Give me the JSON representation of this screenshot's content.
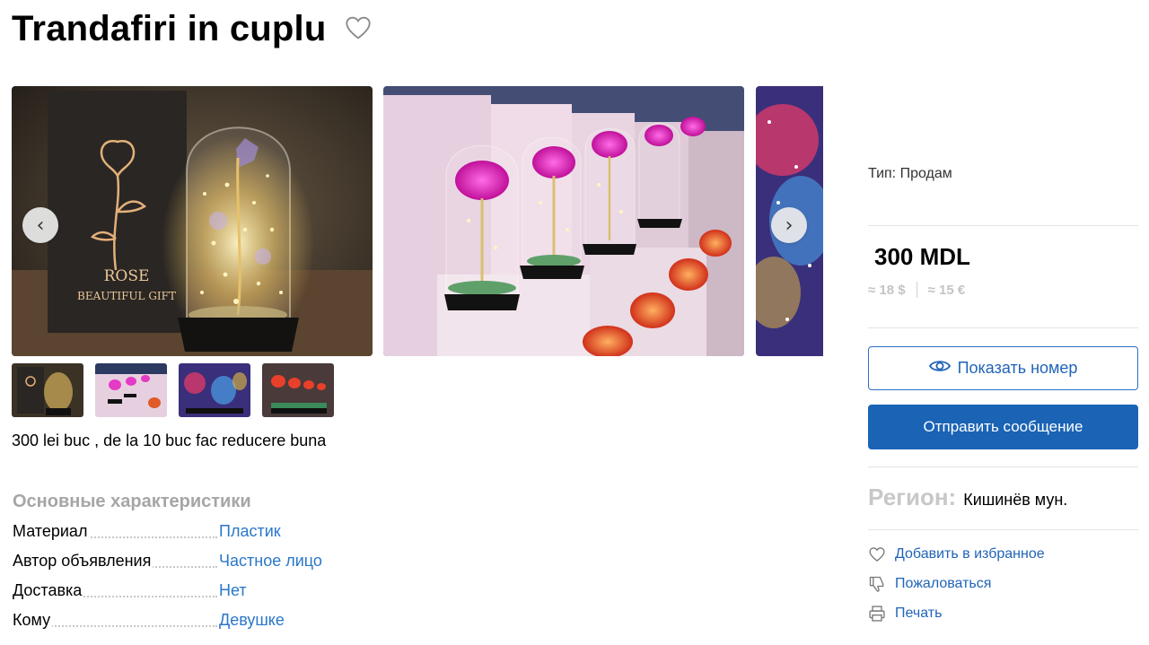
{
  "listing": {
    "title": "Trandafiri in cuplu",
    "description": "300 lei buc , de la 10 buc fac reducere buna"
  },
  "gallery": {
    "slide1": {
      "box_line1": "ROSE",
      "box_line2": "BEAUTIFUL GIFT"
    },
    "prev_icon": "chevron-left-icon",
    "next_icon": "chevron-right-icon",
    "prev_glyph": "‹",
    "next_glyph": "›"
  },
  "characteristics": {
    "title": "Основные характеристики",
    "rows": [
      {
        "label": "Материал",
        "value": "Пластик"
      },
      {
        "label": "Автор объявления",
        "value": "Частное лицо"
      },
      {
        "label": "Доставка",
        "value": "Нет"
      },
      {
        "label": "Кому",
        "value": "Девушке"
      }
    ]
  },
  "sidebar": {
    "type_line": "Тип: Продам",
    "price": "300 MDL",
    "price_usd": "≈ 18 $",
    "price_eur": "≈ 15 €",
    "show_phone_label": "Показать номер",
    "send_message_label": "Отправить сообщение",
    "region_label": "Регион:",
    "region_value": "Кишинёв мун.",
    "actions": [
      {
        "label": "Добавить в избранное",
        "icon": "heart-icon"
      },
      {
        "label": "Пожаловаться",
        "icon": "thumbs-down-icon"
      },
      {
        "label": "Печать",
        "icon": "printer-icon"
      }
    ]
  },
  "colors": {
    "link": "#2a77c9",
    "primary_button": "#1a63b5",
    "muted": "#a6a6a6"
  }
}
